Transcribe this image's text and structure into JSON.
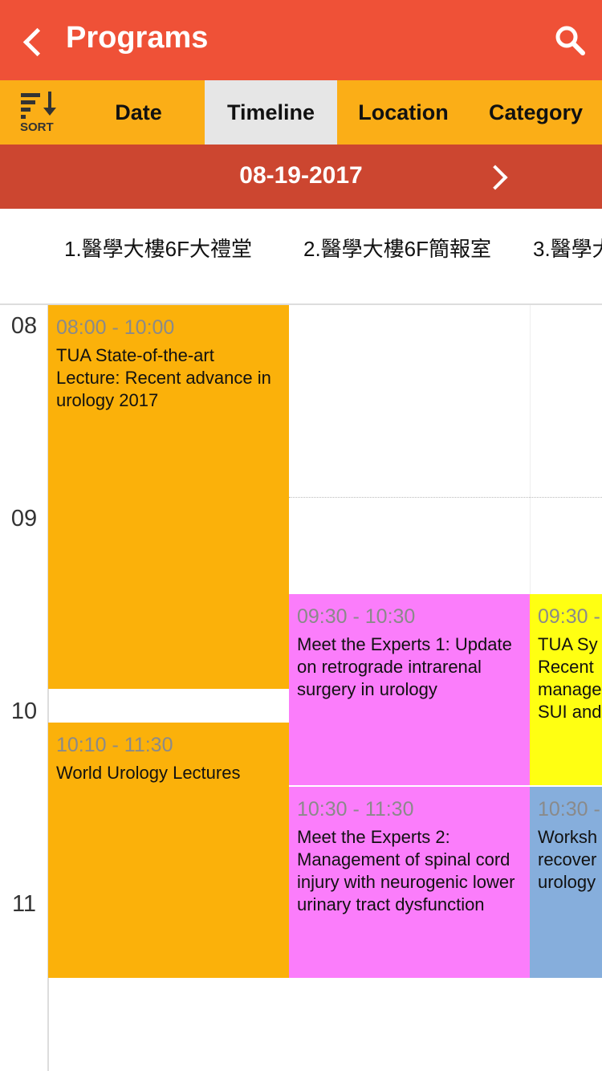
{
  "header": {
    "title": "Programs",
    "back_icon": "chevron-left-icon",
    "search_icon": "search-icon"
  },
  "tabs": {
    "sort_label": "SORT",
    "items": [
      {
        "label": "Date"
      },
      {
        "label": "Timeline",
        "active": true
      },
      {
        "label": "Location"
      },
      {
        "label": "Category"
      }
    ]
  },
  "date_bar": {
    "date": "08-19-2017",
    "next_icon": "chevron-right-icon"
  },
  "locations": [
    "1.醫學大樓6F大禮堂",
    "2.醫學大樓6F簡報室",
    "3.醫學大"
  ],
  "hours": [
    "08",
    "09",
    "10",
    "11"
  ],
  "colors": {
    "header": "#EF5137",
    "tabs": "#FBAE17",
    "date_bar": "#CC4630",
    "orange": "#FBB10A",
    "pink": "#FB7DFB",
    "yellow": "#FFFF12",
    "blue": "#86AEDC"
  },
  "events": [
    {
      "time": "08:00 - 10:00",
      "title": "TUA State-of-the-art Lecture: Recent advance in urology 2017"
    },
    {
      "time": "10:10 - 11:30",
      "title": "World Urology Lectures"
    },
    {
      "time": "09:30 - 10:30",
      "title": "Meet the Experts 1: Update on retrograde intrarenal surgery in urology"
    },
    {
      "time": "10:30 - 11:30",
      "title": "Meet the Experts 2: Management of spinal cord injury with neurogenic lower urinary tract dysfunction"
    },
    {
      "time": "09:30 -",
      "lines": [
        "TUA Sy",
        "Recent",
        "manage",
        "SUI and"
      ]
    },
    {
      "time": "10:30 -",
      "lines": [
        "Worksh",
        "recover",
        "urology"
      ]
    }
  ]
}
